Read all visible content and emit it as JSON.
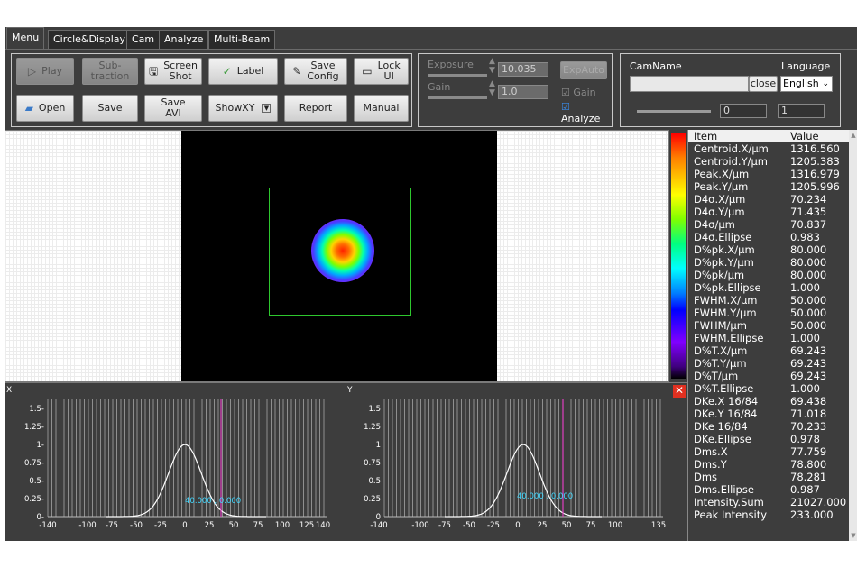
{
  "tabs": [
    "Menu",
    "Circle&Display",
    "Cam",
    "Analyze",
    "Multi-Beam"
  ],
  "toolbar": {
    "play": "Play",
    "subtraction": "Sub-\ntraction",
    "screenshot": "Screen\nShot",
    "label": "Label",
    "save_config": "Save\nConfig",
    "lock_ui": "Lock\nUI",
    "open": "Open",
    "save": "Save",
    "save_avi": "Save\nAVI",
    "showxy": "ShowXY",
    "report": "Report",
    "manual": "Manual"
  },
  "camera": {
    "exposure_label": "Exposure",
    "exposure_value": "10.035",
    "gain_label": "Gain",
    "gain_value": "1.0",
    "expauto": "ExpAuto",
    "gain_check": "Gain",
    "analyze_check": "Analyze"
  },
  "camname": {
    "label": "CamName",
    "value": "",
    "close": "close",
    "language_label": "Language",
    "language_value": "English",
    "slider_value": "0",
    "count_value": "1"
  },
  "profile_x": {
    "title": "X",
    "yticks": [
      "1.5-",
      "1.25-",
      "1-",
      "0.75-",
      "0.5-",
      "0.25-",
      "0-"
    ],
    "xticks": [
      "-140",
      "-100",
      "-75",
      "-50",
      "-25",
      "0",
      "25",
      "50",
      "75",
      "100",
      "125",
      "140"
    ],
    "marker_text": "40.000 , 0.000"
  },
  "profile_y": {
    "title": "Y",
    "yticks": [
      "1.5",
      "1.25",
      "1",
      "0.75",
      "0.5",
      "0.25",
      "0"
    ],
    "xticks": [
      "-140",
      "-100",
      "-75",
      "-50",
      "-25",
      "0",
      "25",
      "50",
      "75",
      "100",
      "135"
    ],
    "marker_text": "40.000 , 0.000"
  },
  "table": {
    "col_item": "Item",
    "col_value": "Value",
    "rows": [
      [
        "Centroid.X/μm",
        "1316.560"
      ],
      [
        "Centroid.Y/μm",
        "1205.383"
      ],
      [
        "Peak.X/μm",
        "1316.979"
      ],
      [
        "Peak.Y/μm",
        "1205.996"
      ],
      [
        "D4σ.X/μm",
        "70.234"
      ],
      [
        "D4σ.Y/μm",
        "71.435"
      ],
      [
        "D4σ/μm",
        "70.837"
      ],
      [
        "D4σ.Ellipse",
        "0.983"
      ],
      [
        "D%pk.X/μm",
        "80.000"
      ],
      [
        "D%pk.Y/μm",
        "80.000"
      ],
      [
        "D%pk/μm",
        "80.000"
      ],
      [
        "D%pk.Ellipse",
        "1.000"
      ],
      [
        "FWHM.X/μm",
        "50.000"
      ],
      [
        "FWHM.Y/μm",
        "50.000"
      ],
      [
        "FWHM/μm",
        "50.000"
      ],
      [
        "FWHM.Ellipse",
        "1.000"
      ],
      [
        "D%T.X/μm",
        "69.243"
      ],
      [
        "D%T.Y/μm",
        "69.243"
      ],
      [
        "D%T/μm",
        "69.243"
      ],
      [
        "D%T.Ellipse",
        "1.000"
      ],
      [
        "DKe.X 16/84",
        "69.438"
      ],
      [
        "DKe.Y 16/84",
        "71.018"
      ],
      [
        "DKe 16/84",
        "70.233"
      ],
      [
        "DKe.Ellipse",
        "0.978"
      ],
      [
        "Dms.X",
        "77.759"
      ],
      [
        "Dms.Y",
        "78.800"
      ],
      [
        "Dms",
        "78.281"
      ],
      [
        "Dms.Ellipse",
        "0.987"
      ],
      [
        "Intensity.Sum",
        "21027.000"
      ],
      [
        "Peak Intensity",
        "233.000"
      ]
    ]
  }
}
